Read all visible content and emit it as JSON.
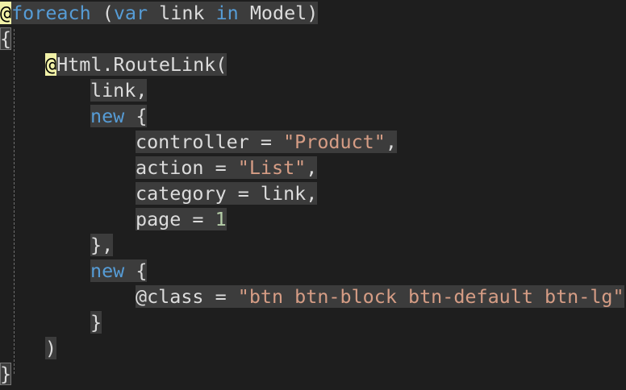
{
  "code": {
    "at": "@",
    "kw_foreach": "foreach",
    "kw_var": "var",
    "kw_in": "in",
    "kw_new": "new",
    "foreach_open_paren": " (",
    "ident_link_in": " link ",
    "model_close": " Model)",
    "brace_open": "{",
    "brace_close": "}",
    "html_routelink": "Html.RouteLink(",
    "arg_link": "link,",
    "space_brace_open": " {",
    "controller_assign": "controller = ",
    "controller_value": "\"Product\"",
    "action_assign": "action = ",
    "action_value": "\"List\"",
    "comma": ",",
    "category_line": "category = link,",
    "page_assign": "page = ",
    "page_value": "1",
    "brace_close_comma": "},",
    "class_assign": "class = ",
    "class_value": "\"btn btn-block btn-default btn-lg\"",
    "close_paren": ")"
  }
}
